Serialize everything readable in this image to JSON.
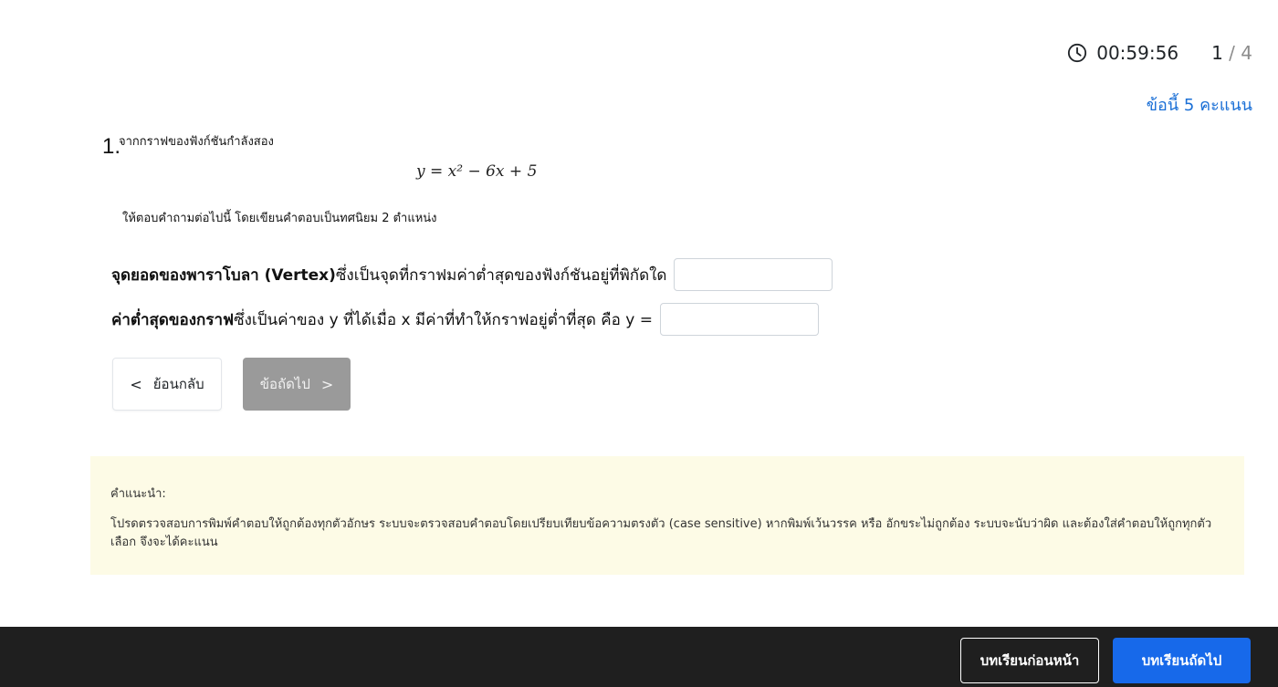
{
  "status": {
    "timer": "00:59:56",
    "page_current": "1",
    "page_separator": "/",
    "page_total": "4",
    "score_label": "ข้อนี้ 5 คะแนน"
  },
  "question": {
    "number": "1.",
    "intro": "จากกราฟของฟังก์ชันกำลังสอง",
    "equation": "y = x² − 6x + 5",
    "instruction": "ให้ตอบคำถามต่อไปนี้ โดยเขียนคำตอบเป็นทศนิยม 2 ตำแหน่ง",
    "items": [
      {
        "bold": "จุดยอดของพาราโบลา (Vertex)",
        "rest": "ซึ่งเป็นจุดที่กราฟมค่าต่ำสุดของฟังก์ชันอยู่ที่พิกัดใด",
        "value": ""
      },
      {
        "bold": "ค่าต่ำสุดของกราฟ",
        "rest": "ซึ่งเป็นค่าของ y ที่ได้เมื่อ x มีค่าที่ทำให้กราฟอยู่ต่ำที่สุด คือ y =",
        "value": ""
      }
    ]
  },
  "nav": {
    "back_label": "ย้อนกลับ",
    "next_label": "ข้อถัดไป"
  },
  "hint": {
    "title": "คำแนะนำ:",
    "body": "โปรดตรวจสอบการพิมพ์คำตอบให้ถูกต้องทุกตัวอักษร ระบบจะตรวจสอบคำตอบโดยเปรียบเทียบข้อความตรงตัว (case sensitive) หากพิมพ์เว้นวรรค หรือ อักขระไม่ถูกต้อง ระบบจะนับว่าผิด และต้องใส่คำตอบให้ถูกทุกตัวเลือก จึงจะได้คะแนน"
  },
  "footer": {
    "prev_lesson": "บทเรียนก่อนหน้า",
    "next_lesson": "บทเรียนถัดไป"
  },
  "colors": {
    "accent": "#1769ea",
    "score_text": "#1a6fd6",
    "hint_bg": "#fdfbe6",
    "footer_bg": "#1f1f1f",
    "disabled_button": "#9a9a9a"
  },
  "icons": {
    "timer": "clock-icon",
    "back": "chevron-left-icon",
    "next": "chevron-right-icon"
  }
}
